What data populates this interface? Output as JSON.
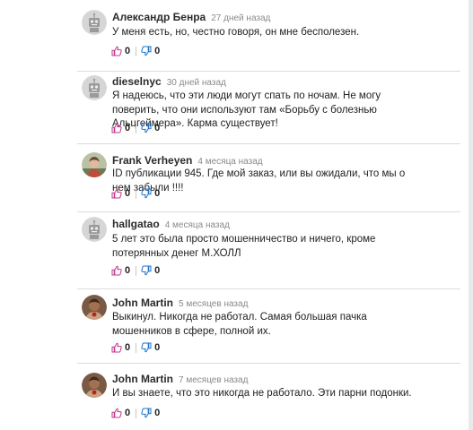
{
  "comments": [
    {
      "author": "Александр Бенра",
      "time": "27 дней назад",
      "text": "У меня есть, но, честно говоря, он мне бесполезен.",
      "likes": "0",
      "dislikes": "0",
      "avatar": "robot-icon"
    },
    {
      "author": "dieselnyc",
      "time": "30 дней назад",
      "text": "Я надеюсь, что эти люди могут спать по ночам. Не могу поверить, что они используют там «Борьбу с болезнью Альцгеймера». Карма существует!",
      "likes": "0",
      "dislikes": "0",
      "avatar": "robot-icon"
    },
    {
      "author": "Frank Verheyen",
      "time": "4 месяца назад",
      "text": "ID публикации 945. Где мой заказ, или вы ожидали, что мы о нем забыли !!!!",
      "likes": "0",
      "dislikes": "0",
      "avatar": "photo"
    },
    {
      "author": "hallgatao",
      "time": "4 месяца назад",
      "text": "5 лет это была просто мошенничество и ничего, кроме потерянных денег М.ХОЛЛ",
      "likes": "0",
      "dislikes": "0",
      "avatar": "robot-icon"
    },
    {
      "author": "John Martin",
      "time": "5 месяцев назад",
      "text": "Выкинул. Никогда не работал. Самая большая пачка мошенников в сфере, полной их.",
      "likes": "0",
      "dislikes": "0",
      "avatar": "photo"
    },
    {
      "author": "John Martin",
      "time": "7 месяцев назад",
      "text": "И вы знаете, что это никогда не работало. Эти парни подонки.",
      "likes": "0",
      "dislikes": "0",
      "avatar": "photo"
    }
  ],
  "colors": {
    "like": "#c0398e",
    "dislike": "#1a73c8"
  }
}
